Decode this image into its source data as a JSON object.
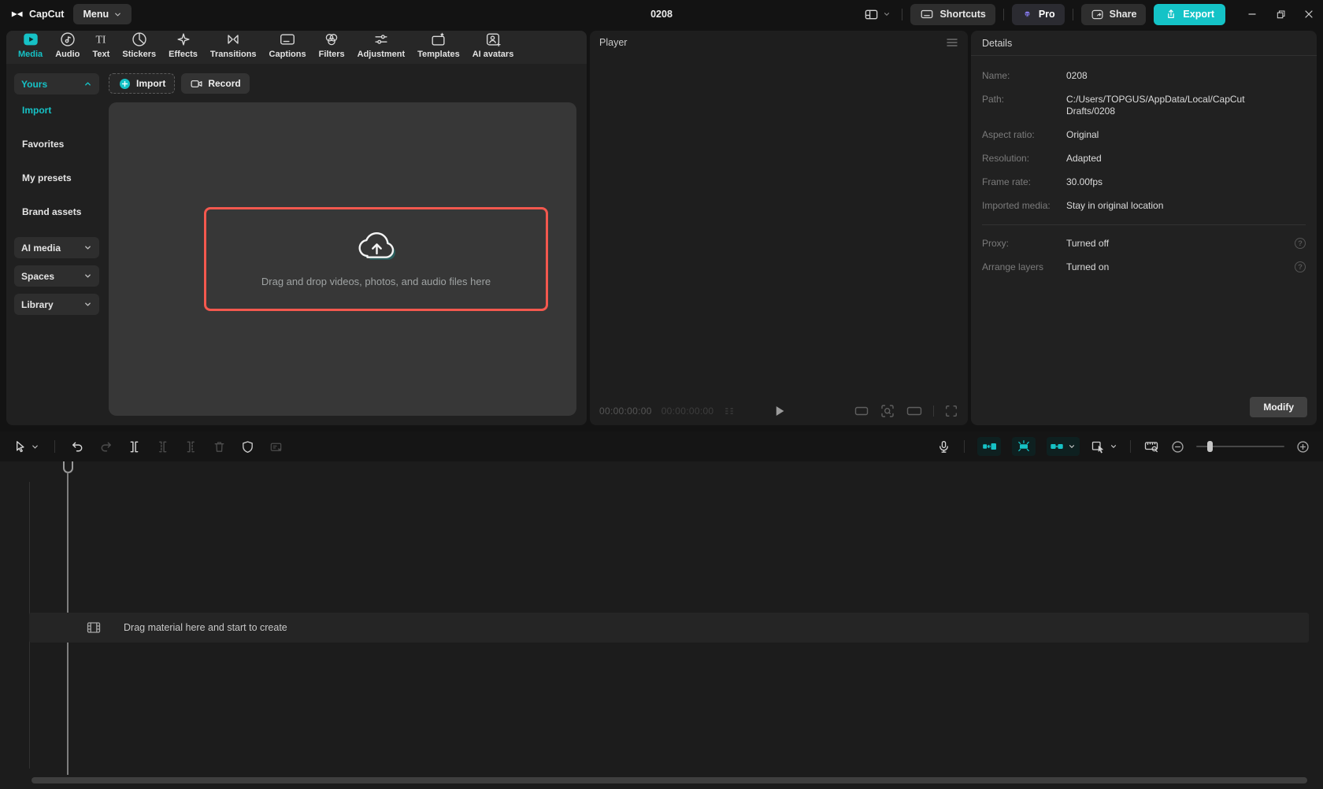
{
  "titlebar": {
    "app_name": "CapCut",
    "menu": "Menu",
    "title": "0208",
    "shortcuts": "Shortcuts",
    "pro": "Pro",
    "share": "Share",
    "export": "Export"
  },
  "tabs": [
    {
      "label": "Media",
      "active": true
    },
    {
      "label": "Audio"
    },
    {
      "label": "Text"
    },
    {
      "label": "Stickers"
    },
    {
      "label": "Effects"
    },
    {
      "label": "Transitions"
    },
    {
      "label": "Captions"
    },
    {
      "label": "Filters"
    },
    {
      "label": "Adjustment"
    },
    {
      "label": "Templates"
    },
    {
      "label": "AI avatars"
    }
  ],
  "sidebar": {
    "yours": "Yours",
    "items": [
      {
        "label": "Import"
      },
      {
        "label": "Favorites"
      },
      {
        "label": "My presets"
      },
      {
        "label": "Brand assets"
      }
    ],
    "groups": [
      {
        "label": "AI media"
      },
      {
        "label": "Spaces"
      },
      {
        "label": "Library"
      }
    ]
  },
  "media": {
    "import": "Import",
    "record": "Record",
    "dropzone": "Drag and drop videos, photos, and audio files here"
  },
  "player": {
    "title": "Player",
    "time_current": "00:00:00:00",
    "time_total": "00:00:00:00"
  },
  "details": {
    "title": "Details",
    "rows": [
      {
        "label": "Name:",
        "value": "0208"
      },
      {
        "label": "Path:",
        "value": "C:/Users/TOPGUS/AppData/Local/CapCut Drafts/0208"
      },
      {
        "label": "Aspect ratio:",
        "value": "Original"
      },
      {
        "label": "Resolution:",
        "value": "Adapted"
      },
      {
        "label": "Frame rate:",
        "value": "30.00fps"
      },
      {
        "label": "Imported media:",
        "value": "Stay in original location"
      }
    ],
    "toggles": [
      {
        "label": "Proxy:",
        "value": "Turned off"
      },
      {
        "label": "Arrange layers",
        "value": "Turned on"
      }
    ],
    "modify": "Modify"
  },
  "timeline": {
    "placeholder": "Drag material here and start to create",
    "zoom_slider_position": "15%"
  },
  "colors": {
    "accent": "#16c2c6",
    "danger": "#f4584e",
    "pro_purple": "#8a7ef6",
    "export_bg": "#14c3c7"
  },
  "icons": {
    "capcut-logo": "⧓",
    "menu-chevron": "⌄",
    "layout": "▦",
    "keyboard": "⌨",
    "pro-diamond": "◆",
    "share": "↗",
    "export": "↥",
    "minimize": "–",
    "restore": "❐",
    "close": "✕",
    "hamburger": "≡",
    "play": "▶",
    "fullscreen": "⛶",
    "cloud-upload": "☁↑",
    "microphone": "mic",
    "zoom-out": "⊖",
    "zoom-in": "⊕",
    "help": "?"
  }
}
